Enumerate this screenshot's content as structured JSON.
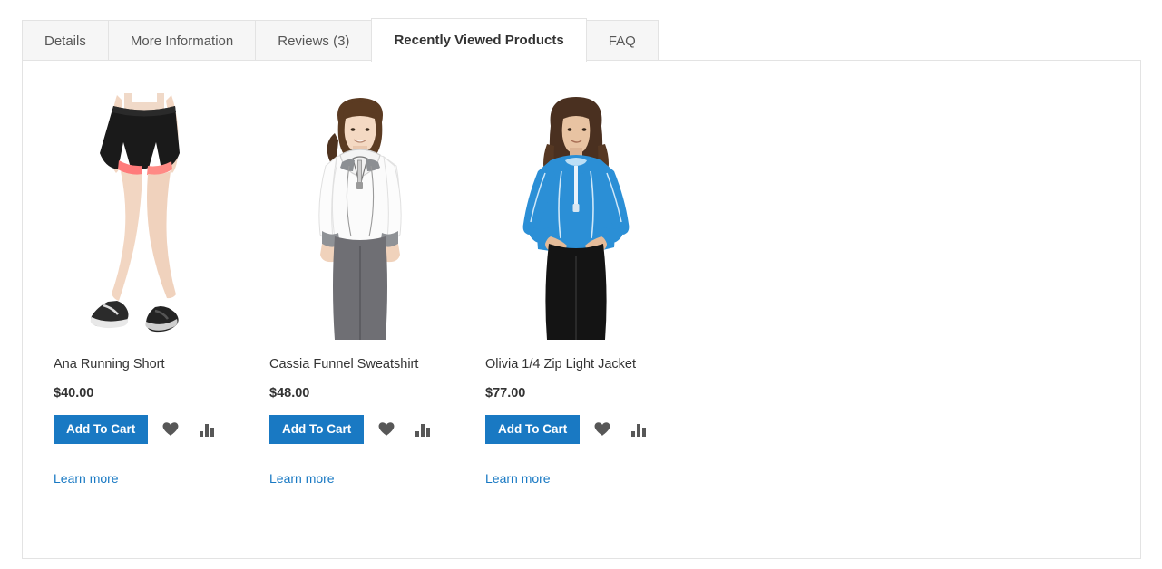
{
  "tabs": [
    {
      "label": "Details",
      "active": false
    },
    {
      "label": "More Information",
      "active": false
    },
    {
      "label": "Reviews (3)",
      "active": false
    },
    {
      "label": "Recently Viewed Products",
      "active": true
    },
    {
      "label": "FAQ",
      "active": false
    }
  ],
  "colors": {
    "accent": "#1979c3",
    "text": "#333333",
    "tab_inactive_text": "#575757",
    "tab_inactive_bg": "#f6f6f6",
    "border": "#e3e3e3",
    "icon_gray": "#575757"
  },
  "products": [
    {
      "name": "Ana Running Short",
      "price": "$40.00",
      "add_to_cart_label": "Add To Cart",
      "wishlist_icon": "heart-icon",
      "compare_icon": "compare-bars-icon",
      "learn_more_label": "Learn more",
      "image_alt": "Ana Running Short"
    },
    {
      "name": "Cassia Funnel Sweatshirt",
      "price": "$48.00",
      "add_to_cart_label": "Add To Cart",
      "wishlist_icon": "heart-icon",
      "compare_icon": "compare-bars-icon",
      "learn_more_label": "Learn more",
      "image_alt": "Cassia Funnel Sweatshirt"
    },
    {
      "name": "Olivia 1/4 Zip Light Jacket",
      "price": "$77.00",
      "add_to_cart_label": "Add To Cart",
      "wishlist_icon": "heart-icon",
      "compare_icon": "compare-bars-icon",
      "learn_more_label": "Learn more",
      "image_alt": "Olivia 1/4 Zip Light Jacket"
    }
  ]
}
